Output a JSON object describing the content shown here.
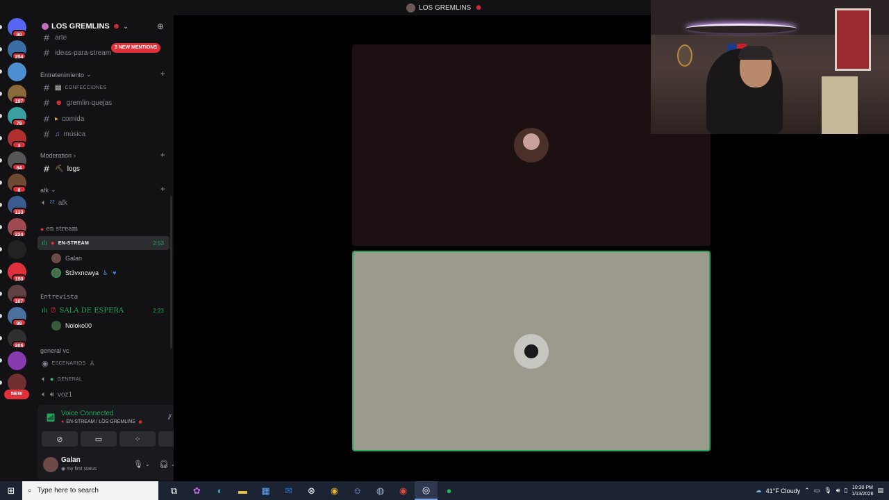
{
  "window": {
    "title": "LOS GREMLINS",
    "title_emoji": "☻"
  },
  "rail": {
    "items": [
      {
        "badge": "80",
        "color": "#5865f2"
      },
      {
        "badge": "254",
        "color": "#3a6ea5"
      },
      {
        "badge": "",
        "color": "#4d8fd1"
      },
      {
        "badge": "197",
        "color": "#8a6a3a"
      },
      {
        "badge": "79",
        "color": "#3aa0a0"
      },
      {
        "badge": "3",
        "color": "#b03030"
      },
      {
        "badge": "84",
        "color": "#555555"
      },
      {
        "badge": "8",
        "color": "#704a30"
      },
      {
        "badge": "133",
        "color": "#3a5a90"
      },
      {
        "badge": "224",
        "color": "#a04a50"
      },
      {
        "badge": "",
        "color": "#222222"
      },
      {
        "badge": "150",
        "color": "#e0303a"
      },
      {
        "badge": "107",
        "color": "#604040"
      },
      {
        "badge": "98",
        "color": "#4a70a0"
      },
      {
        "badge": "205",
        "color": "#303030"
      },
      {
        "badge": "",
        "color": "#8a3ab0"
      },
      {
        "badge": "",
        "color": "#703030"
      }
    ],
    "new_label": "NEW"
  },
  "server": {
    "name": "LOS GREMLINS",
    "mentions": "3 NEW MENTIONS"
  },
  "channels": {
    "arte": "arte",
    "ideas": "ideas-para-stream",
    "cat_entretenimiento": "Entretenimiento",
    "confecciones": "CONFECCIONES",
    "gremlin_quejas": "gremlin-quejas",
    "comida": "comida",
    "musica": "música",
    "cat_moderation": "Moderation",
    "logs": "logs",
    "cat_afk": "afk",
    "afk": "afk",
    "cat_en_stream": "en stream",
    "en_stream": "EN-STREAM",
    "en_stream_time": "2:53",
    "user_galan": "Galan",
    "user_st3": "St3vxncwya",
    "cat_entrevista": "Entrevista",
    "sala": "SALA DE ESPERA",
    "sala_time": "2:23",
    "user_noloko": "Noloko00",
    "cat_general_vc": "general vc",
    "escenarios": "ESCENARIOS",
    "general": "GENERAL",
    "voz1": "voz1"
  },
  "voice": {
    "status": "Voice Connected",
    "location": "EN-STREAM / LOS GREMLINS"
  },
  "user": {
    "name": "Galan",
    "status": "my first status"
  },
  "taskbar": {
    "search_placeholder": "Type here to search",
    "weather": "41°F Cloudy",
    "time": "10:30 PM",
    "date": "1/13/2026"
  },
  "colors": {
    "accent_green": "#23a55a",
    "mention_red": "#e0303a"
  }
}
